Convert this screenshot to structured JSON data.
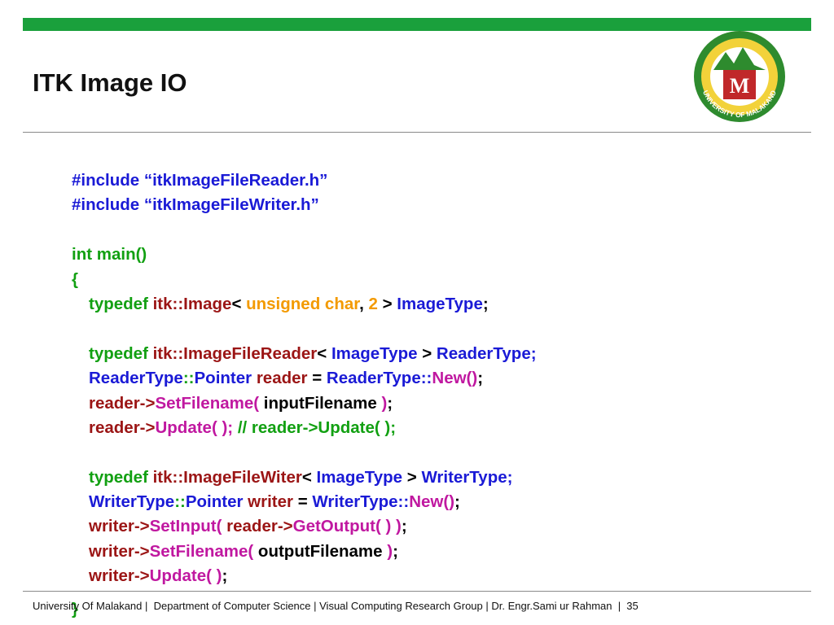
{
  "slide": {
    "title": "ITK Image IO",
    "footer": "University Of Malakand |  Department of Computer Science | Visual Computing Research Group | Dr. Engr.Sami ur Rahman  |  35"
  },
  "logo": {
    "ring_text": "UNIVERSITY OF MALAKAND",
    "letter": "M"
  },
  "colors": {
    "green": "#1aa03c",
    "keyword": "#12a012",
    "itk": "#9b1515",
    "type": "#1a1ad6",
    "accent": "#c018a0",
    "literal": "#f39a00",
    "plain": "#000000"
  },
  "code": {
    "lines": [
      {
        "indent": false,
        "tokens": [
          {
            "t": "#include “itkImageFileReader.h”",
            "c": "type"
          }
        ]
      },
      {
        "indent": false,
        "tokens": [
          {
            "t": "#include “itkImageFileWriter.h”",
            "c": "type"
          }
        ]
      },
      {
        "indent": false,
        "tokens": []
      },
      {
        "indent": false,
        "tokens": [
          {
            "t": "int main()",
            "c": "keyword"
          }
        ]
      },
      {
        "indent": false,
        "tokens": [
          {
            "t": "{",
            "c": "keyword"
          }
        ]
      },
      {
        "indent": true,
        "tokens": [
          {
            "t": "typedef ",
            "c": "keyword"
          },
          {
            "t": "itk::Image",
            "c": "itk"
          },
          {
            "t": "< ",
            "c": "plain"
          },
          {
            "t": "unsigned char",
            "c": "literal"
          },
          {
            "t": ", ",
            "c": "plain"
          },
          {
            "t": "2",
            "c": "literal"
          },
          {
            "t": " > ",
            "c": "plain"
          },
          {
            "t": "ImageType",
            "c": "type"
          },
          {
            "t": ";",
            "c": "plain"
          }
        ]
      },
      {
        "indent": true,
        "tokens": []
      },
      {
        "indent": true,
        "tokens": [
          {
            "t": "typedef ",
            "c": "keyword"
          },
          {
            "t": "itk::ImageFileReader",
            "c": "itk"
          },
          {
            "t": "< ",
            "c": "plain"
          },
          {
            "t": "ImageType",
            "c": "type"
          },
          {
            "t": " > ",
            "c": "plain"
          },
          {
            "t": "ReaderType;",
            "c": "type"
          }
        ]
      },
      {
        "indent": true,
        "tokens": [
          {
            "t": "ReaderType",
            "c": "type"
          },
          {
            "t": "::",
            "c": "keyword"
          },
          {
            "t": "Pointer ",
            "c": "type"
          },
          {
            "t": "reader",
            "c": "itk"
          },
          {
            "t": " = ",
            "c": "plain"
          },
          {
            "t": "ReaderType::",
            "c": "type"
          },
          {
            "t": "New()",
            "c": "accent"
          },
          {
            "t": ";",
            "c": "plain"
          }
        ]
      },
      {
        "indent": true,
        "tokens": [
          {
            "t": "reader->",
            "c": "itk"
          },
          {
            "t": "SetFilename( ",
            "c": "accent"
          },
          {
            "t": "inputFilename ",
            "c": "plain"
          },
          {
            "t": ")",
            "c": "accent"
          },
          {
            "t": ";",
            "c": "plain"
          }
        ]
      },
      {
        "indent": true,
        "tokens": [
          {
            "t": "reader->",
            "c": "itk"
          },
          {
            "t": "Update( ); ",
            "c": "accent"
          },
          {
            "t": "// reader->Update( );",
            "c": "keyword"
          }
        ]
      },
      {
        "indent": true,
        "tokens": []
      },
      {
        "indent": true,
        "tokens": [
          {
            "t": "typedef ",
            "c": "keyword"
          },
          {
            "t": "itk::ImageFileWiter",
            "c": "itk"
          },
          {
            "t": "< ",
            "c": "plain"
          },
          {
            "t": "ImageType",
            "c": "type"
          },
          {
            "t": " > ",
            "c": "plain"
          },
          {
            "t": "WriterType;",
            "c": "type"
          }
        ]
      },
      {
        "indent": true,
        "tokens": [
          {
            "t": "WriterType",
            "c": "type"
          },
          {
            "t": "::",
            "c": "keyword"
          },
          {
            "t": "Pointer ",
            "c": "type"
          },
          {
            "t": "writer",
            "c": "itk"
          },
          {
            "t": " = ",
            "c": "plain"
          },
          {
            "t": "WriterType::",
            "c": "type"
          },
          {
            "t": "New()",
            "c": "accent"
          },
          {
            "t": ";",
            "c": "plain"
          }
        ]
      },
      {
        "indent": true,
        "tokens": [
          {
            "t": "writer->",
            "c": "itk"
          },
          {
            "t": "SetInput( ",
            "c": "accent"
          },
          {
            "t": "reader->",
            "c": "itk"
          },
          {
            "t": "GetOutput( ) )",
            "c": "accent"
          },
          {
            "t": ";",
            "c": "plain"
          }
        ]
      },
      {
        "indent": true,
        "tokens": [
          {
            "t": "writer->",
            "c": "itk"
          },
          {
            "t": "SetFilename( ",
            "c": "accent"
          },
          {
            "t": "outputFilename ",
            "c": "plain"
          },
          {
            "t": ")",
            "c": "accent"
          },
          {
            "t": ";",
            "c": "plain"
          }
        ]
      },
      {
        "indent": true,
        "tokens": [
          {
            "t": "writer->",
            "c": "itk"
          },
          {
            "t": "Update( )",
            "c": "accent"
          },
          {
            "t": ";",
            "c": "plain"
          }
        ]
      }
    ],
    "closing": "}"
  }
}
